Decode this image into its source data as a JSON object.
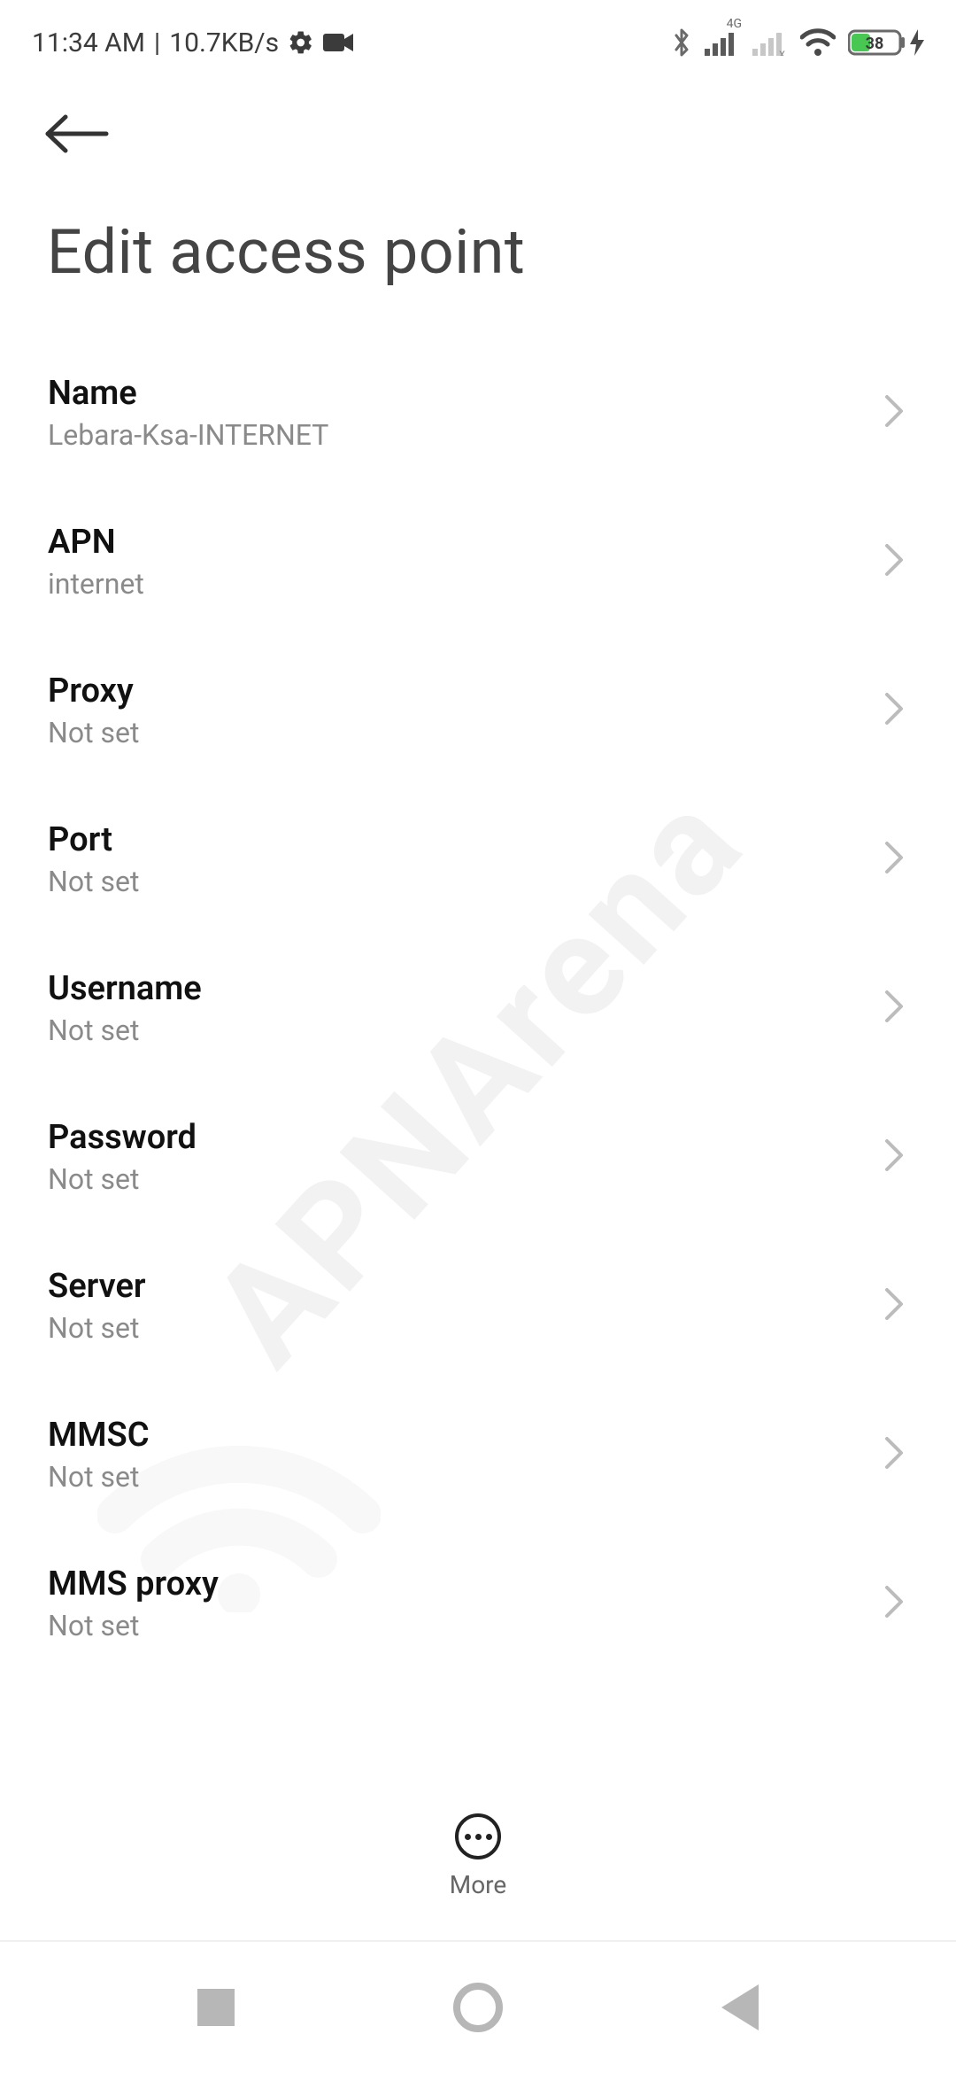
{
  "status": {
    "time": "11:34 AM",
    "separator": "|",
    "netspeed": "10.7KB/s",
    "battery_pct": "38",
    "network_label": "4G"
  },
  "header": {
    "title": "Edit access point"
  },
  "rows": [
    {
      "label": "Name",
      "value": "Lebara-Ksa-INTERNET"
    },
    {
      "label": "APN",
      "value": "internet"
    },
    {
      "label": "Proxy",
      "value": "Not set"
    },
    {
      "label": "Port",
      "value": "Not set"
    },
    {
      "label": "Username",
      "value": "Not set"
    },
    {
      "label": "Password",
      "value": "Not set"
    },
    {
      "label": "Server",
      "value": "Not set"
    },
    {
      "label": "MMSC",
      "value": "Not set"
    },
    {
      "label": "MMS proxy",
      "value": "Not set"
    }
  ],
  "bottom": {
    "more_label": "More"
  },
  "watermark": {
    "text": "APNArena"
  }
}
